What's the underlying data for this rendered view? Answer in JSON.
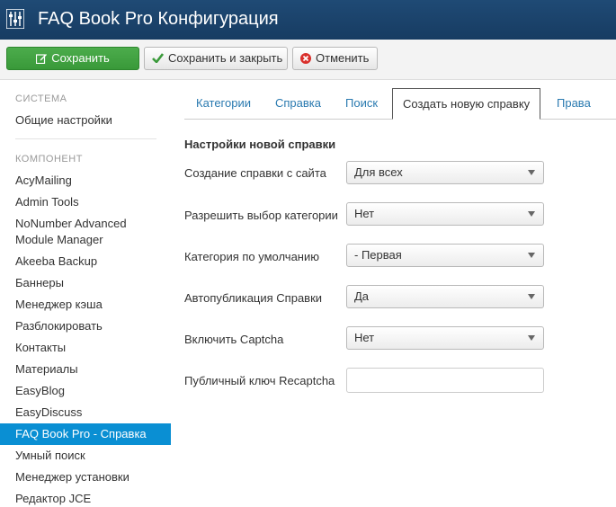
{
  "header": {
    "title": "FAQ Book Pro Конфигурация",
    "logo_icon": "joomla-config-icon"
  },
  "toolbar": {
    "save_label": "Сохранить",
    "save_close_label": "Сохранить и закрыть",
    "cancel_label": "Отменить"
  },
  "sidebar": {
    "system_heading": "СИСТЕМА",
    "system_items": [
      "Общие настройки"
    ],
    "component_heading": "КОМПОНЕНТ",
    "component_items": [
      "AcyMailing",
      "Admin Tools",
      "NoNumber Advanced",
      "Module Manager",
      "Akeeba Backup",
      "Баннеры",
      "Менеджер кэша",
      "Разблокировать",
      "Контакты",
      "Материалы",
      "EasyBlog",
      "EasyDiscuss",
      "FAQ Book Pro - Справка",
      "Умный поиск",
      "Менеджер установки",
      "Редактор JCE"
    ],
    "active_item": "FAQ Book Pro - Справка"
  },
  "tabs": [
    {
      "label": "Категории"
    },
    {
      "label": "Справка"
    },
    {
      "label": "Поиск"
    },
    {
      "label": "Создать новую справку",
      "active": true
    },
    {
      "label": "Права"
    }
  ],
  "form": {
    "section_title": "Настройки новой справки",
    "fields": [
      {
        "label": "Создание справки с сайта",
        "value": "Для всех"
      },
      {
        "label": "Разрешить выбор категории",
        "value": "Нет"
      },
      {
        "label": "Категория по умолчанию",
        "value": "- Первая"
      },
      {
        "label": "Автопубликация Справки",
        "value": "Да"
      },
      {
        "label": "Включить Captcha",
        "value": "Нет"
      },
      {
        "label": "Публичный ключ Recaptcha",
        "value": ""
      }
    ]
  },
  "colors": {
    "header_bg": "#1f4a75",
    "save_green": "#3f9f3f",
    "active_item_bg": "#0a8fd3",
    "tab_link": "#2a7ab0",
    "cancel_red": "#d9302c"
  }
}
